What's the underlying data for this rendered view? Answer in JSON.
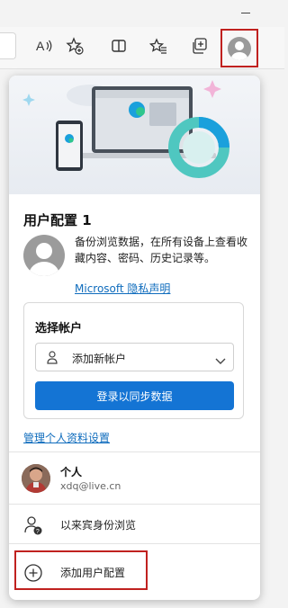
{
  "flyout": {
    "profile_title": "用户配置 1",
    "backup_text": "备份浏览数据，在所有设备上查看收藏内容、密码、历史记录等。",
    "privacy_link": "Microsoft 隐私声明",
    "account": {
      "heading": "选择帐户",
      "select_value": "添加新帐户",
      "signin_button": "登录以同步数据"
    },
    "manage_link": "管理个人资料设置",
    "other_profile": {
      "name": "个人",
      "email": "xdq@live.cn"
    },
    "guest_label": "以来宾身份浏览",
    "add_profile_label": "添加用户配置"
  },
  "colors": {
    "accent_blue": "#1474d4",
    "link_blue": "#0f6cbd",
    "highlight_red": "#c0211f"
  },
  "icons": {
    "read_aloud": "read-aloud-icon",
    "add_favorite": "add-favorite-icon",
    "split_screen": "split-screen-icon",
    "favorites": "favorites-icon",
    "collections": "collections-icon",
    "profile": "profile-icon",
    "guest": "guest-icon",
    "add": "plus-circle-icon"
  }
}
